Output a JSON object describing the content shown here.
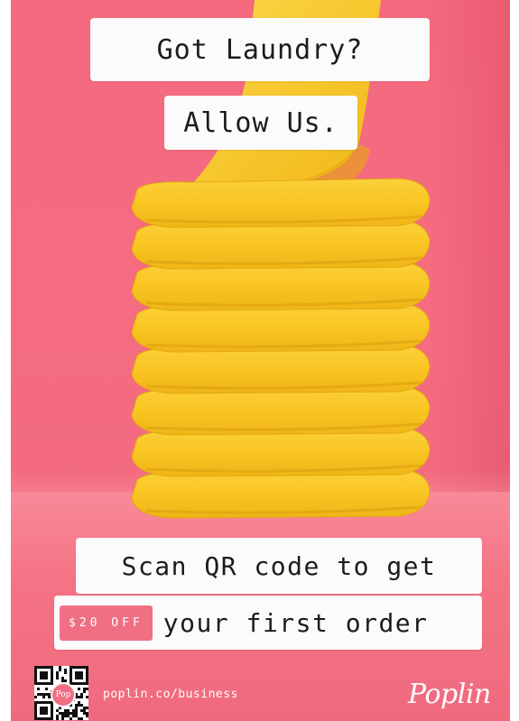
{
  "headline": {
    "line1": "Got Laundry?",
    "line2": "Allow Us."
  },
  "offer": {
    "line1": "Scan QR code to get",
    "badge": "$20 OFF",
    "line2": "your first order"
  },
  "footer": {
    "url": "poplin.co/business",
    "brand": "Poplin",
    "qr_badge_text": "Pop"
  },
  "colors": {
    "background": "#f4697e",
    "towel": "#f9c623",
    "badge": "#f06f83",
    "box": "#fbfbfb"
  },
  "imagery": {
    "towel_stack_count": 8,
    "icon": "qr-code-icon"
  }
}
